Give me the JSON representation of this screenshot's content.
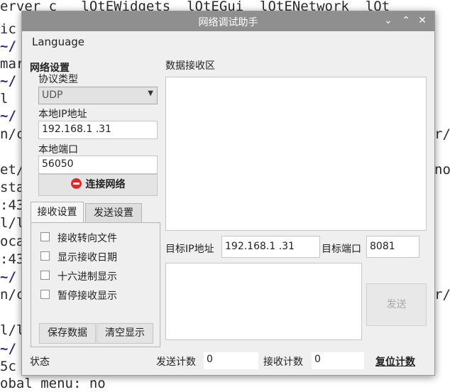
{
  "terminal": {
    "lines": [
      "erver_c   lQtEWidgets  lQtEGui  lQtENetwork  lQt",
      "ic",
      "~/",
      "mar",
      "~/",
      "l",
      "~/",
      "n/c",
      "",
      "et/",
      "sta",
      ":43",
      "l/l",
      "oca",
      ":43",
      "~/",
      "n/c",
      "",
      "l/l",
      "~/",
      "5c",
      "obal menu: no"
    ],
    "right_fragments": [
      "r/",
      "no",
      "r/"
    ]
  },
  "window": {
    "title": "网络调试助手",
    "minimize_glyph": "⌄",
    "maximize_glyph": "⌃",
    "close_glyph": "✕"
  },
  "menu": {
    "language": "Language"
  },
  "network_settings": {
    "heading": "网络设置",
    "protocol_label": "协议类型",
    "protocol_value": "UDP",
    "local_ip_label": "本地IP地址",
    "local_ip_value": "192.168.1  .31",
    "local_port_label": "本地端口",
    "local_port_value": "56050",
    "connect_button": "连接网络"
  },
  "tabs": {
    "receive_tab": "接收设置",
    "send_tab": "发送设置",
    "options": [
      "接收转向文件",
      "显示接收日期",
      "十六进制显示",
      "暂停接收显示"
    ],
    "save_button": "保存数据",
    "clear_button": "清空显示"
  },
  "receive_area": {
    "label": "数据接收区"
  },
  "target": {
    "ip_label": "目标IP地址",
    "ip_value": "192.168.1  .31",
    "port_label": "目标端口",
    "port_value": "8081"
  },
  "send": {
    "button": "发送"
  },
  "status": {
    "label": "状态",
    "sent_label": "发送计数",
    "sent_value": "0",
    "recv_label": "接收计数",
    "recv_value": "0",
    "reset_button": "复位计数"
  }
}
